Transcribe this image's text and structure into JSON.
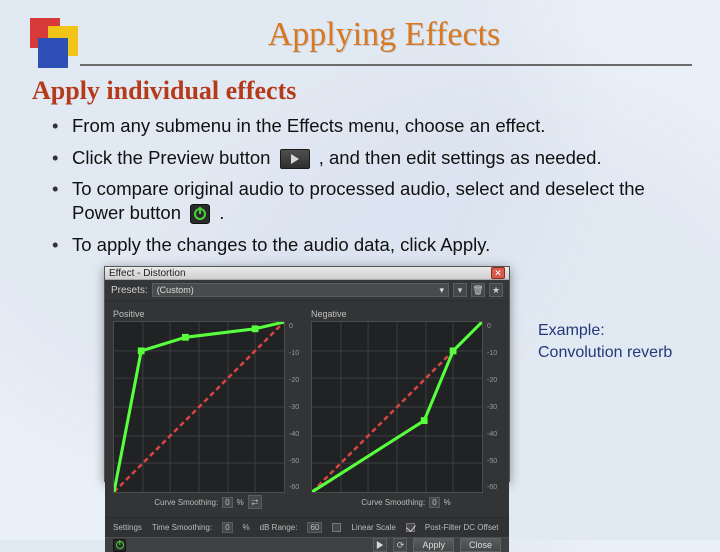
{
  "title": "Applying Effects",
  "subtitle": "Apply individual effects",
  "bullets": {
    "b1": "From any submenu in the Effects menu, choose an effect.",
    "b2a": "Click the Preview button ",
    "b2b": ", and then edit settings as needed.",
    "b3a": "To compare original audio to processed audio, select and deselect the Power button ",
    "b3b": ".",
    "b4": "To apply the changes to the audio data, click Apply."
  },
  "caption": {
    "l1": "Example:",
    "l2": "Convolution reverb"
  },
  "dialog": {
    "title": "Effect - Distortion",
    "presets_label": "Presets:",
    "preset_value": "(Custom)",
    "pos_label": "Positive",
    "neg_label": "Negative",
    "curve_smoothing": "Curve Smoothing:",
    "curve_value": "0",
    "pct": "%",
    "settings_label": "Settings",
    "time_smoothing": "Time Smoothing:",
    "time_value": "0",
    "db_range": "dB Range:",
    "db_value": "60",
    "linear_scale": "Linear Scale",
    "post_filter": "Post-Filter DC Offset",
    "apply": "Apply",
    "close": "Close",
    "y_ticks": [
      "0",
      "-10",
      "-20",
      "-30",
      "-40",
      "-50",
      "-60"
    ]
  },
  "chart_data": [
    {
      "type": "line",
      "title": "Positive",
      "xlabel": "",
      "ylabel": "",
      "xlim": [
        -60,
        0
      ],
      "ylim": [
        -60,
        0
      ],
      "series": [
        {
          "name": "positive-curve",
          "color": "#57ff3d",
          "x": [
            -60,
            -50,
            -35,
            -10,
            0
          ],
          "y": [
            -60,
            -10,
            -5,
            -2,
            0
          ]
        },
        {
          "name": "reference",
          "color": "#ff5757",
          "dashed": true,
          "x": [
            -60,
            0
          ],
          "y": [
            -60,
            0
          ]
        }
      ]
    },
    {
      "type": "line",
      "title": "Negative",
      "xlabel": "",
      "ylabel": "",
      "xlim": [
        -60,
        0
      ],
      "ylim": [
        -60,
        0
      ],
      "series": [
        {
          "name": "negative-curve",
          "color": "#57ff3d",
          "x": [
            -60,
            -20,
            -10,
            0
          ],
          "y": [
            -60,
            -35,
            -10,
            0
          ]
        },
        {
          "name": "reference",
          "color": "#ff5757",
          "dashed": true,
          "x": [
            -60,
            0
          ],
          "y": [
            -60,
            0
          ]
        }
      ]
    }
  ]
}
